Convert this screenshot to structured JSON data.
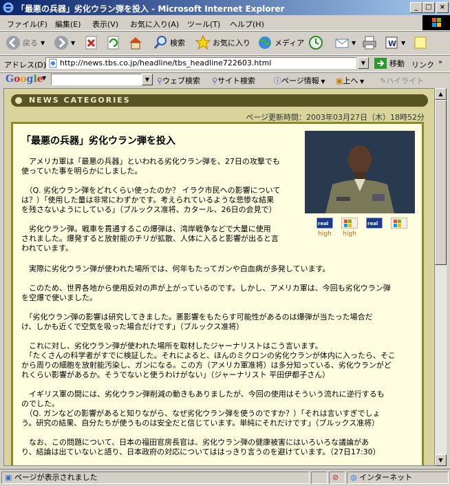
{
  "window": {
    "title": "「最悪の兵器」劣化ウラン弾を投入 - Microsoft Internet Explorer"
  },
  "menu": [
    "ファイル(F)",
    "編集(E)",
    "表示(V)",
    "お気に入り(A)",
    "ツール(T)",
    "ヘルプ(H)"
  ],
  "toolbar": {
    "back": "戻る",
    "search": "検索",
    "favorites": "お気に入り",
    "media": "メディア"
  },
  "address": {
    "label": "アドレス(D)",
    "url": "http://news.tbs.co.jp/headline/tbs_headline722603.html",
    "go": "移動",
    "links": "リンク"
  },
  "google": {
    "logo": "Google",
    "web_search": "ウェブ検索",
    "site_search": "サイト検索",
    "page_info": "ページ情報",
    "up": "上へ",
    "highlight": "ハイライト"
  },
  "page": {
    "category_label": "NEWS CATEGORIES",
    "updated": "ページ更新時間：2003年03月27日（木）18時52分",
    "headline": "「最悪の兵器」劣化ウラン弾を投入",
    "media": [
      {
        "type": "real",
        "quality": "high"
      },
      {
        "type": "wmp",
        "quality": "high"
      },
      {
        "type": "real",
        "quality": ""
      },
      {
        "type": "wmp",
        "quality": ""
      }
    ],
    "paragraphs": [
      [
        "　アメリカ軍は「最悪の兵器」といわれる劣化ウラン弾を、27日の攻撃でも",
        "使っていた事を明らかにしました。"
      ],
      [
        "　（Q. 劣化ウラン弾をどれくらい使ったのか？ イラク市民への影響について",
        "は？）「使用した量は非常にわずかです。考えられているような悲惨な結果",
        "を残さないようにしている」（ブルックス准将、カタール、26日の会見で）"
      ],
      [
        "　劣化ウラン弾。戦車を貫通するこの爆弾は、湾岸戦争などで大量に使用",
        "されました。爆発すると放射能のチリが拡散、人体に入ると影響が出ると言",
        "われています。"
      ],
      [
        "　実際に劣化ウラン弾が使われた場所では、何年もたってガンや白血病が多発しています。"
      ],
      [
        "　このため、世界各地から使用反対の声が上がっているのです。しかし、アメリカ軍は、今回も劣化ウラン弾",
        "を空爆で使いました。"
      ],
      [
        "　「劣化ウラン弾の影響は研究してきました。悪影響をもたらす可能性があるのは爆弾が当たった場合だ",
        "け、しかも近くで空気を吸った場合だけです」（ブルックス准将）"
      ],
      [
        "　これに対し、劣化ウラン弾が使われた場所を取材したジャーナリストはこう言います。",
        "　「たくさんの科学者がすでに検証した。それによると、ほんのミクロンの劣化ウランが体内に入ったら、そこ",
        "から周りの細胞を放射能汚染し、ガンになる。この方（アメリカ軍准将）は多分知っている、劣化ウランがど",
        "れくらい影響があるか。そうでないと使うわけがない」（ジャーナリスト 平田伊都子さん）"
      ],
      [
        "　イギリス軍の間には、劣化ウラン弾削減の動きもありましたが、今回の使用はそういう流れに逆行するも",
        "のでした。",
        "　（Q. ガンなどの影響があると知りながら、なぜ劣化ウラン弾を使うのですか？）「それは言いすぎでしょ",
        "う。研究の結果、自分たちが使うものは安全だと信じています。単純にそれだけです」（ブルックス准将）"
      ],
      [
        "　なお、この問題について、日本の福田官房長官は、劣化ウラン弾の健康被害にはいろいろな議論があ",
        "り、結論は出ていないと語り、日本政府の対応についてははっきり言うのを避けています。（27日17:30）"
      ]
    ]
  },
  "status": {
    "text": "ページが表示されました",
    "zone": "インターネット"
  }
}
